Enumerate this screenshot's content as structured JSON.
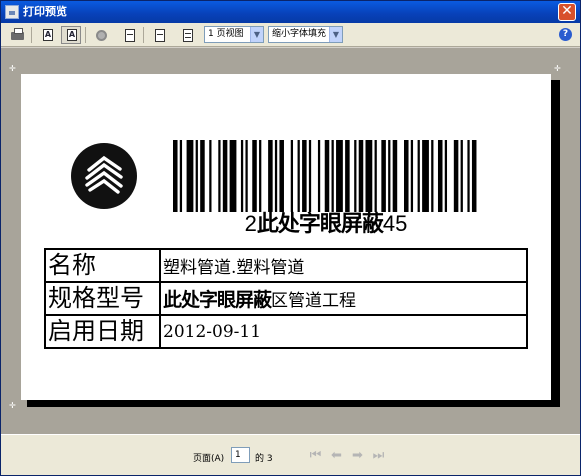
{
  "window": {
    "title": "打印预览",
    "close_label": "✕"
  },
  "toolbar": {
    "zoom_a_label": "A",
    "zoom_b_label": "A",
    "view_select": "1 页视图",
    "fit_select": "缩小字体填充",
    "help_label": "?"
  },
  "label": {
    "barcode_prefix": "2",
    "barcode_mask": "此处字眼屏蔽",
    "barcode_suffix": "45",
    "rows": [
      {
        "label": "名称",
        "value": "塑料管道.塑料管道",
        "mask": "",
        "value_after": ""
      },
      {
        "label": "规格型号",
        "value": "",
        "mask": "此处字眼屏蔽",
        "value_after": "区管道工程"
      },
      {
        "label": "启用日期",
        "value": "2012-09-11",
        "mask": "",
        "value_after": ""
      }
    ]
  },
  "status": {
    "page_label": "页面(A)",
    "page_value": "1",
    "page_of": "的 3"
  },
  "colors": {
    "title_bar": "#0841b8",
    "preview_bg": "#a8a49a"
  }
}
